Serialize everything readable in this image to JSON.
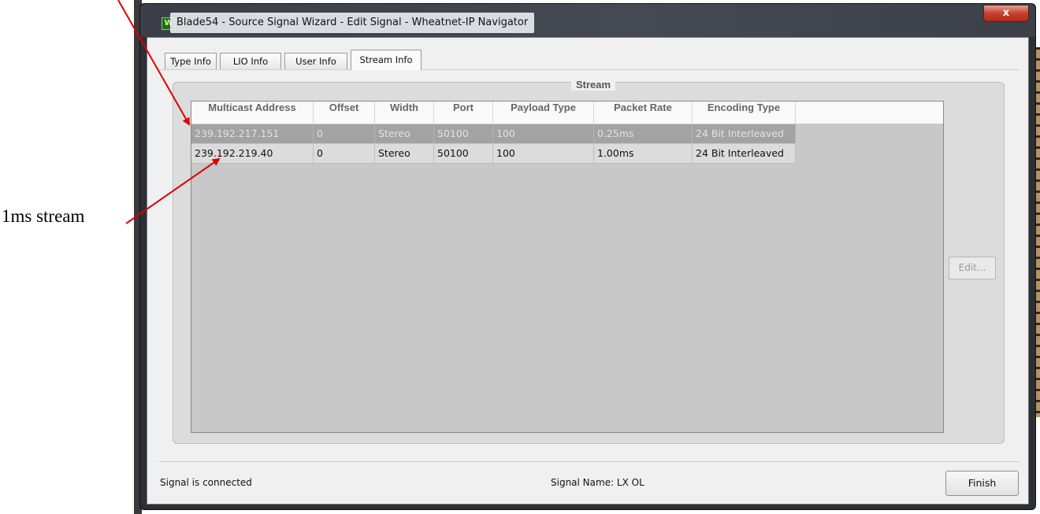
{
  "annotation": {
    "label": "1ms stream"
  },
  "window": {
    "icon_text": "W",
    "title": "Blade54 - Source Signal Wizard - Edit Signal - Wheatnet-IP Navigator",
    "close_label": "x"
  },
  "tabs": [
    {
      "label": "Type Info",
      "active": false
    },
    {
      "label": "LIO Info",
      "active": false
    },
    {
      "label": "User Info",
      "active": false
    },
    {
      "label": "Stream Info",
      "active": true
    }
  ],
  "stream_group": {
    "title": "Stream",
    "columns": [
      "Multicast Address",
      "Offset",
      "Width",
      "Port",
      "Payload Type",
      "Packet Rate",
      "Encoding Type"
    ],
    "rows": [
      {
        "state": "selected",
        "cells": [
          "239.192.217.151",
          "0",
          "Stereo",
          "50100",
          "100",
          "0.25ms",
          "24 Bit Interleaved"
        ]
      },
      {
        "state": "normal",
        "cells": [
          "239.192.219.40",
          "0",
          "Stereo",
          "50100",
          "100",
          "1.00ms",
          "24 Bit Interleaved"
        ]
      }
    ],
    "edit_label": "Edit..."
  },
  "footer": {
    "status": "Signal is connected",
    "signal_name": "Signal Name:  LX OL",
    "finish_label": "Finish"
  },
  "colors": {
    "selected_row": "#a3a3a3",
    "table_body": "#c8c8c8",
    "annotation_arrow": "#e00000"
  }
}
